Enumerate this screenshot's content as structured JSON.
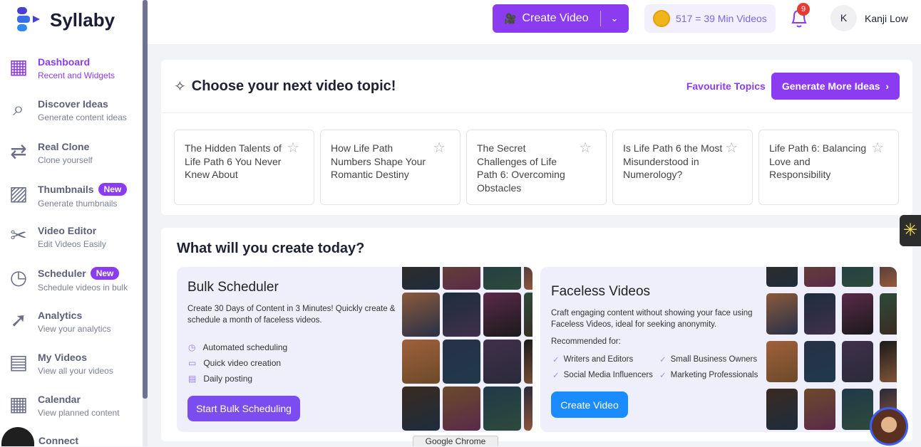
{
  "app": {
    "name": "Syllaby"
  },
  "sidebar": {
    "items": [
      {
        "label": "Dashboard",
        "sub": "Recent and Widgets",
        "icon": "grid-icon"
      },
      {
        "label": "Discover Ideas",
        "sub": "Generate content ideas",
        "icon": "search-icon"
      },
      {
        "label": "Real Clone",
        "sub": "Clone yourself",
        "icon": "swap-icon"
      },
      {
        "label": "Thumbnails",
        "sub": "Generate thumbnails",
        "badge": "New",
        "icon": "image-icon"
      },
      {
        "label": "Video Editor",
        "sub": "Edit Videos Easily",
        "icon": "scissors-icon"
      },
      {
        "label": "Scheduler",
        "sub": "Schedule videos in bulk",
        "badge": "New",
        "icon": "clock-icon"
      },
      {
        "label": "Analytics",
        "sub": "View your analytics",
        "icon": "rocket-icon"
      },
      {
        "label": "My Videos",
        "sub": "View all your videos",
        "icon": "videos-icon"
      },
      {
        "label": "Calendar",
        "sub": "View planned content",
        "icon": "calendar-icon"
      }
    ],
    "connect": "Connect"
  },
  "header": {
    "create_video": "Create Video",
    "credits": "517 = 39 Min Videos",
    "notifications": "9",
    "avatar_initial": "K",
    "user": "Kanji Low"
  },
  "topics": {
    "title": "Choose your next video topic!",
    "favourite": "Favourite Topics",
    "generate": "Generate More Ideas",
    "items": [
      "The Hidden Talents of Life Path 6 You Never Knew About",
      "How Life Path Numbers Shape Your Romantic Destiny",
      "The Secret Challenges of Life Path 6: Overcoming Obstacles",
      "Is Life Path 6 the Most Misunderstood in Numerology?",
      "Life Path 6: Balancing Love and Responsibility"
    ]
  },
  "create": {
    "title": "What will you create today?",
    "bulk": {
      "title": "Bulk Scheduler",
      "desc": "Create 30 Days of Content in 3 Minutes! Quickly create & schedule a month of faceless videos.",
      "features": [
        "Automated scheduling",
        "Quick video creation",
        "Daily posting"
      ],
      "button": "Start Bulk Scheduling"
    },
    "faceless": {
      "title": "Faceless Videos",
      "desc": "Craft engaging content without showing your face using Faceless Videos, ideal for seeking anonymity.",
      "recommended": "Recommended for:",
      "audiences": [
        "Writers and Editors",
        "Small Business Owners",
        "Social Media Influencers",
        "Marketing Professionals"
      ],
      "button": "Create Video"
    }
  },
  "tooltip": "Google Chrome",
  "colors": {
    "accent": "#8b3cf0",
    "blue": "#1a8cff"
  }
}
